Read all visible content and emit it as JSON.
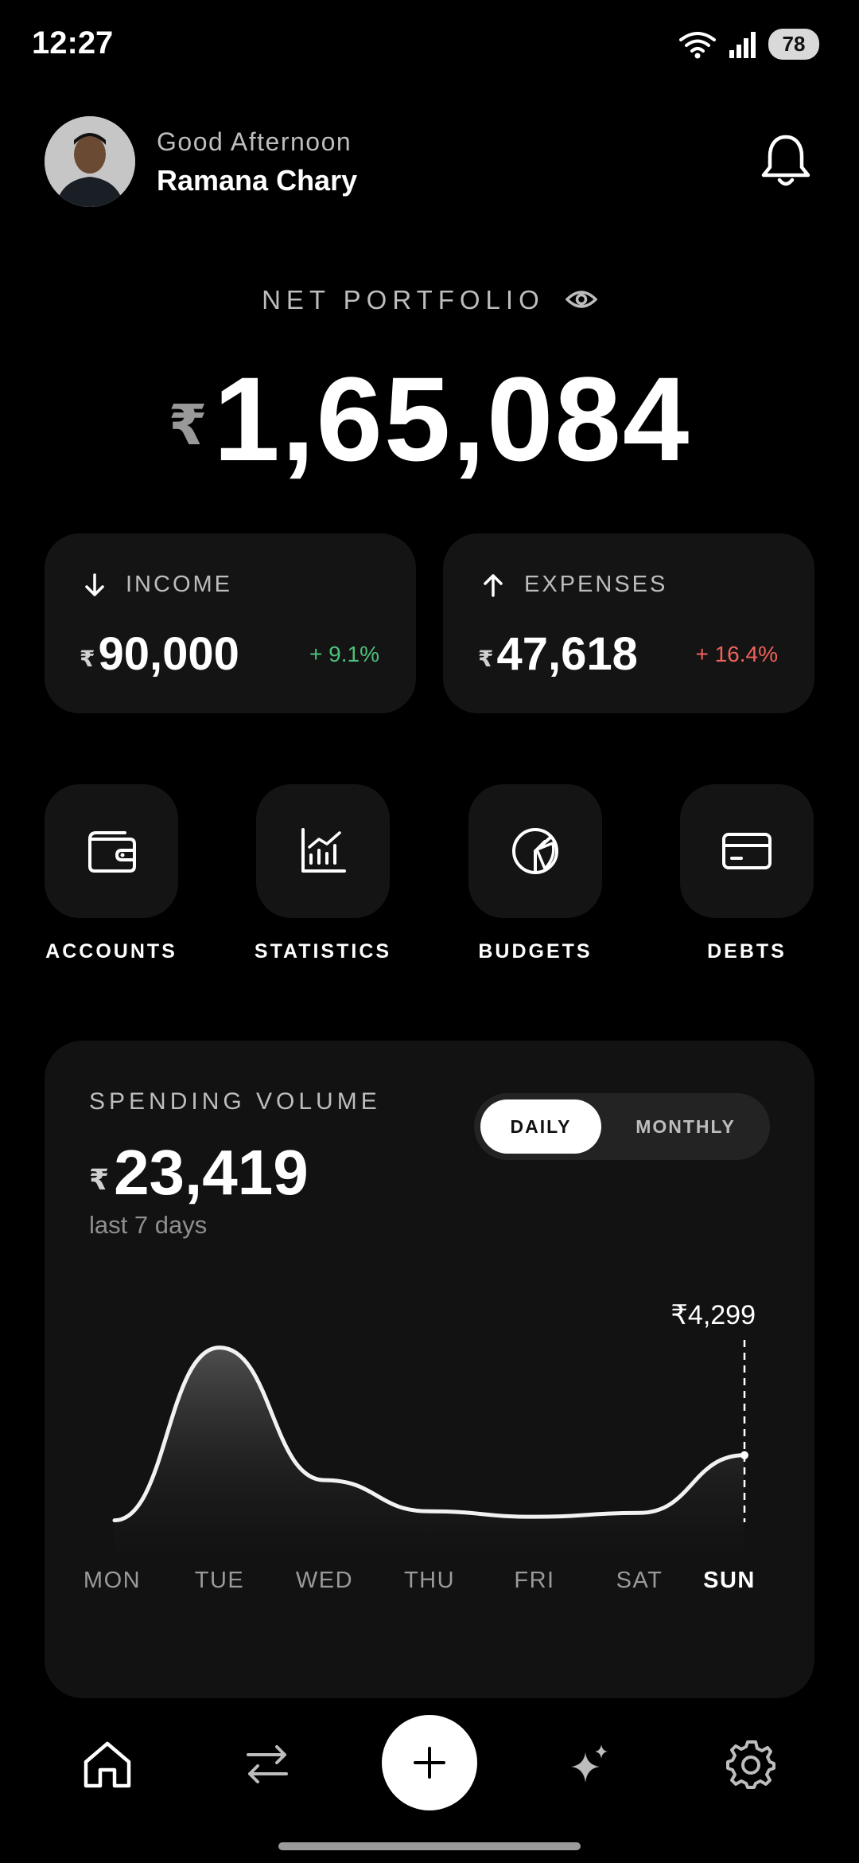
{
  "status_bar": {
    "time": "12:27",
    "battery": "78"
  },
  "header": {
    "greeting": "Good Afternoon",
    "user_name": "Ramana Chary"
  },
  "portfolio": {
    "label": "NET PORTFOLIO",
    "currency": "₹",
    "amount": "1,65,084"
  },
  "income": {
    "label": "INCOME",
    "currency": "₹",
    "amount": "90,000",
    "delta": "+ 9.1%"
  },
  "expenses": {
    "label": "EXPENSES",
    "currency": "₹",
    "amount": "47,618",
    "delta": "+ 16.4%"
  },
  "quick_actions": [
    {
      "label": "ACCOUNTS",
      "icon": "wallet-icon"
    },
    {
      "label": "STATISTICS",
      "icon": "chart-icon"
    },
    {
      "label": "BUDGETS",
      "icon": "pie-icon"
    },
    {
      "label": "DEBTS",
      "icon": "card-icon"
    }
  ],
  "spending": {
    "label": "SPENDING VOLUME",
    "currency": "₹",
    "amount": "23,419",
    "subtitle": "last 7 days",
    "toggle": {
      "daily": "DAILY",
      "monthly": "MONTHLY",
      "selected": "DAILY"
    }
  },
  "colors": {
    "positive": "#4ec07a",
    "negative": "#f0625b",
    "card": "#141414"
  },
  "chart_data": {
    "type": "area",
    "categories": [
      "MON",
      "TUE",
      "WED",
      "THU",
      "FRI",
      "SAT",
      "SUN"
    ],
    "highlight_index": 6,
    "highlight_label": "₹4,299",
    "series": [
      {
        "values": [
          120,
          11200,
          2700,
          700,
          350,
          600,
          4299
        ]
      }
    ],
    "ylim": [
      0,
      12000
    ],
    "grid": false
  },
  "bottom_nav": [
    "home-icon",
    "transfer-icon",
    "add-icon",
    "sparkle-icon",
    "settings-icon"
  ]
}
